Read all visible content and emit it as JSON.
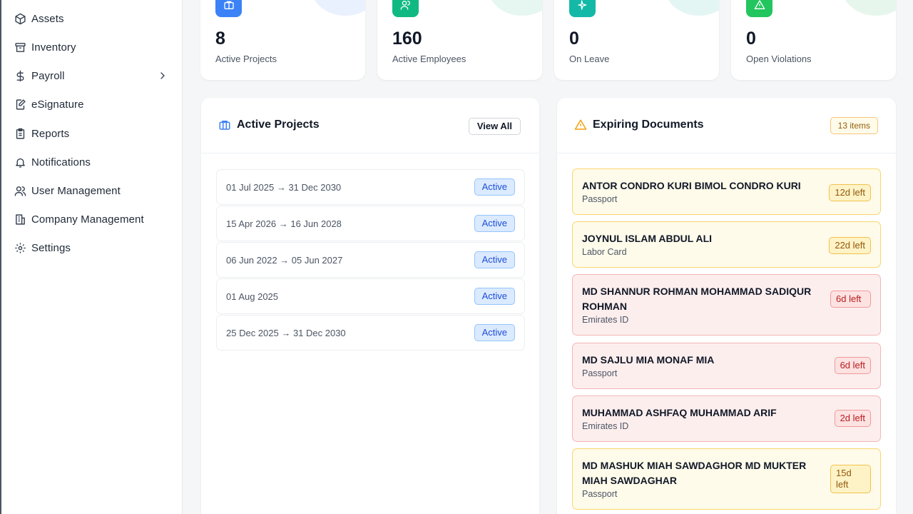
{
  "sidebar": {
    "items": [
      {
        "label": "Assets",
        "icon": "cube-icon"
      },
      {
        "label": "Inventory",
        "icon": "archive-icon"
      },
      {
        "label": "Payroll",
        "icon": "dollar-icon"
      },
      {
        "label": "eSignature",
        "icon": "signature-icon"
      },
      {
        "label": "Reports",
        "icon": "clipboard-icon"
      },
      {
        "label": "Notifications",
        "icon": "bell-icon"
      },
      {
        "label": "User Management",
        "icon": "users-icon"
      },
      {
        "label": "Company Management",
        "icon": "building-icon"
      },
      {
        "label": "Settings",
        "icon": "gear-icon"
      }
    ]
  },
  "stats": [
    {
      "value": "8",
      "label": "Active Projects",
      "icon": "briefcase-icon",
      "color": "#3b82f6"
    },
    {
      "value": "160",
      "label": "Active Employees",
      "icon": "users-icon",
      "color": "#10b981"
    },
    {
      "value": "0",
      "label": "On Leave",
      "icon": "plane-icon",
      "color": "#14b8a6"
    },
    {
      "value": "0",
      "label": "Open Violations",
      "icon": "warning-icon",
      "color": "#22c55e"
    }
  ],
  "projects": {
    "title": "Active Projects",
    "view_all": "View All",
    "rows": [
      {
        "dates": "01 Jul 2025 → 31 Dec 2030",
        "status": "Active"
      },
      {
        "dates": "15 Apr 2026 → 16 Jun 2028",
        "status": "Active"
      },
      {
        "dates": "06 Jun 2022 → 05 Jun 2027",
        "status": "Active"
      },
      {
        "dates": "01 Aug 2025",
        "status": "Active"
      },
      {
        "dates": "25 Dec 2025 → 31 Dec 2030",
        "status": "Active"
      }
    ]
  },
  "documents": {
    "title": "Expiring Documents",
    "count_badge": "13 items",
    "rows": [
      {
        "name": "ANTOR CONDRO KURI BIMOL CONDRO KURI",
        "type": "Passport",
        "left": "12d left",
        "level": "warn"
      },
      {
        "name": "JOYNUL ISLAM ABDUL ALI",
        "type": "Labor Card",
        "left": "22d left",
        "level": "warn"
      },
      {
        "name": "MD SHANNUR ROHMAN MOHAMMAD SADIQUR ROHMAN",
        "type": "Emirates ID",
        "left": "6d left",
        "level": "danger"
      },
      {
        "name": "MD SAJLU MIA MONAF MIA",
        "type": "Passport",
        "left": "6d left",
        "level": "danger"
      },
      {
        "name": "MUHAMMAD ASHFAQ MUHAMMAD ARIF",
        "type": "Emirates ID",
        "left": "2d left",
        "level": "danger"
      },
      {
        "name": "MD MASHUK MIAH SAWDAGHOR MD MUKTER MIAH SAWDAGHAR",
        "type": "Passport",
        "left": "15d left",
        "level": "warn"
      }
    ]
  }
}
